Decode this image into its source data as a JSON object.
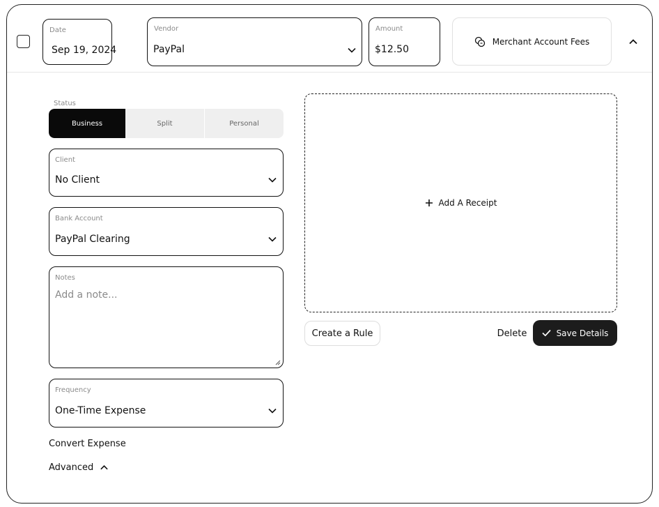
{
  "header": {
    "date": {
      "label": "Date",
      "value": "Sep 19, 2024"
    },
    "vendor": {
      "label": "Vendor",
      "value": "PayPal"
    },
    "amount": {
      "label": "Amount",
      "value": "$12.50"
    },
    "category": {
      "label": "Merchant Account Fees",
      "icon": "coins-icon"
    }
  },
  "status": {
    "label": "Status",
    "options": [
      "Business",
      "Split",
      "Personal"
    ],
    "selected": "Business"
  },
  "client": {
    "label": "Client",
    "value": "No Client"
  },
  "bank_account": {
    "label": "Bank Account",
    "value": "PayPal Clearing"
  },
  "notes": {
    "label": "Notes",
    "placeholder": "Add a note..."
  },
  "frequency": {
    "label": "Frequency",
    "value": "One-Time Expense"
  },
  "links": {
    "convert": "Convert Expense",
    "advanced": "Advanced"
  },
  "receipt": {
    "label": "Add A Receipt"
  },
  "actions": {
    "create_rule": "Create a Rule",
    "delete": "Delete",
    "save": "Save Details"
  },
  "colors": {
    "primary": "#0a0a0a",
    "border": "#111111",
    "muted": "#8a8a8a"
  }
}
